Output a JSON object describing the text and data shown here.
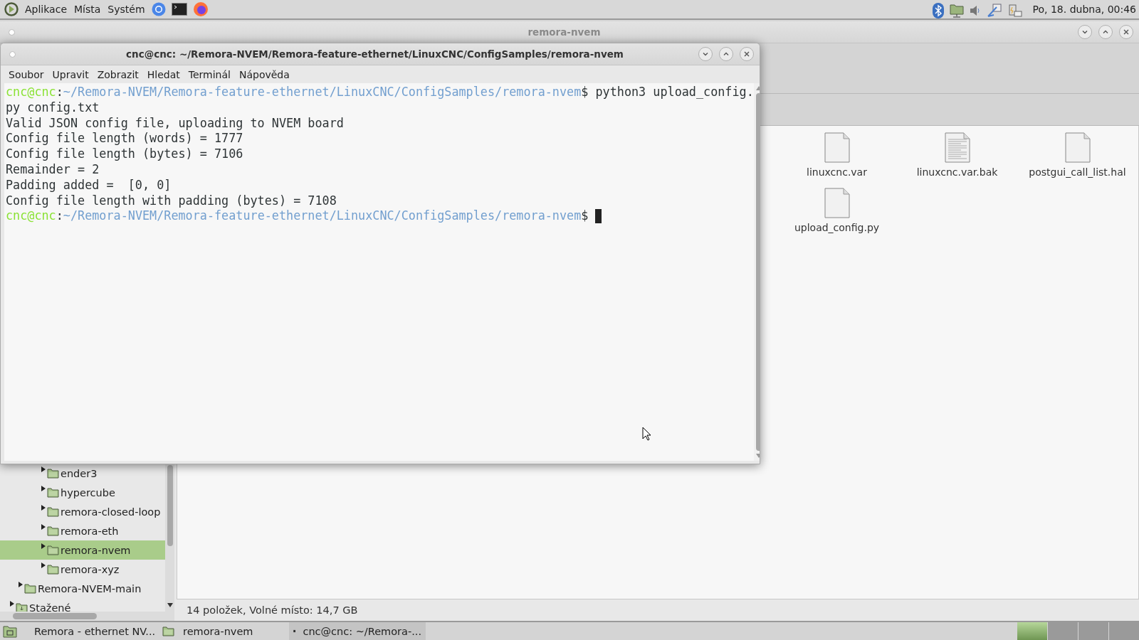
{
  "top_panel": {
    "menus": [
      "Aplikace",
      "Místa",
      "Systém"
    ],
    "clock": "Po, 18. dubna, 00:46"
  },
  "file_manager": {
    "title": "remora-nvem",
    "sidebar": {
      "items": [
        {
          "children": [
            {
              "children": [
                {
                  "label": "ender3",
                  "kind": "folder",
                  "selected": false
                },
                {
                  "label": "hypercube",
                  "kind": "folder",
                  "selected": false
                },
                {
                  "label": "remora-closed-loop",
                  "kind": "folder",
                  "selected": false
                },
                {
                  "label": "remora-eth",
                  "kind": "folder",
                  "selected": false
                },
                {
                  "label": "remora-nvem",
                  "kind": "folder",
                  "selected": true
                },
                {
                  "label": "remora-xyz",
                  "kind": "folder",
                  "selected": false
                }
              ]
            },
            {
              "label": "Remora-NVEM-main",
              "kind": "folder",
              "selected": false
            }
          ]
        },
        {
          "label": "Stažené",
          "kind": "downloads",
          "selected": false
        }
      ]
    },
    "files": [
      {
        "name": "linuxcnc.var",
        "kind": "blank"
      },
      {
        "name": "linuxcnc.var.bak",
        "kind": "text"
      },
      {
        "name": "postgui_call_list.hal",
        "kind": "blank"
      },
      {
        "name": "upload_config.py",
        "kind": "blank"
      }
    ],
    "status_bar": "14 položek, Volné místo: 14,7 GB"
  },
  "terminal": {
    "title": "cnc@cnc: ~/Remora-NVEM/Remora-feature-ethernet/LinuxCNC/ConfigSamples/remora-nvem",
    "menu": [
      "Soubor",
      "Upravit",
      "Zobrazit",
      "Hledat",
      "Terminál",
      "Nápověda"
    ],
    "lines": [
      {
        "kind": "prompt",
        "user": "cnc@cnc",
        "separator": ":",
        "path": "~/Remora-NVEM/Remora-feature-ethernet/LinuxCNC/ConfigSamples/remora-nvem",
        "sign": "$",
        "command": "python3 upload_config.",
        "cursor": false
      },
      {
        "kind": "output",
        "text": "py config.txt"
      },
      {
        "kind": "output",
        "text": "Valid JSON config file, uploading to NVEM board"
      },
      {
        "kind": "output",
        "text": "Config file length (words) = 1777"
      },
      {
        "kind": "output",
        "text": "Config file length (bytes) = 7106"
      },
      {
        "kind": "output",
        "text": "Remainder = 2"
      },
      {
        "kind": "output",
        "text": "Padding added =  [0, 0]"
      },
      {
        "kind": "output",
        "text": "Config file length with padding (bytes) = 7108"
      },
      {
        "kind": "prompt",
        "user": "cnc@cnc",
        "separator": ":",
        "path": "~/Remora-NVEM/Remora-feature-ethernet/LinuxCNC/ConfigSamples/remora-nvem",
        "sign": "$",
        "cursor": true
      }
    ]
  },
  "taskbar": {
    "tasks": [
      {
        "label": "Remora - ethernet NV...",
        "kind": "browser",
        "selected": false
      },
      {
        "label": "remora-nvem",
        "kind": "folder",
        "selected": false
      },
      {
        "label": "cnc@cnc: ~/Remora-...",
        "kind": "terminal",
        "selected": true
      }
    ],
    "workspaces": [
      {
        "selected": true
      },
      {
        "selected": false
      },
      {
        "selected": false
      },
      {
        "selected": false
      }
    ]
  }
}
